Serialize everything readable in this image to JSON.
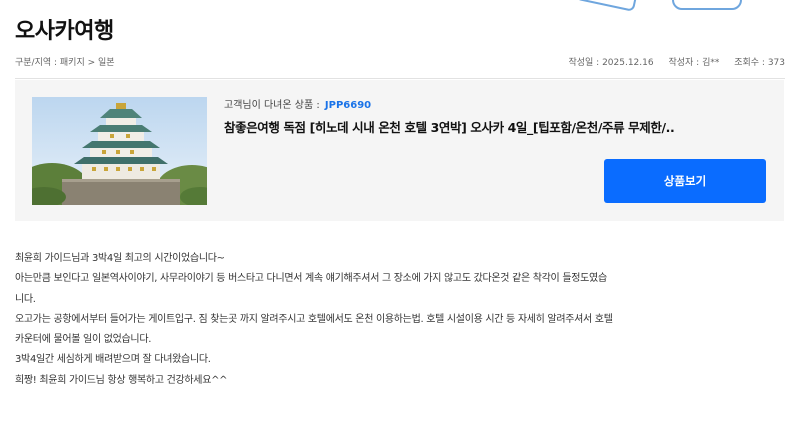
{
  "page": {
    "title": "오사카여행"
  },
  "meta": {
    "breadcrumb": "구분/지역 : 패키지 > 일본",
    "date": "작성일 : 2025.12.16",
    "author": "작성자 : 김**",
    "views": "조회수 : 373"
  },
  "product": {
    "code_label": "고객님이 다녀온 상품 :",
    "code": "JPP6690",
    "name": "참좋은여행 독점 [히노데 시내 온천 호텔 3연박] 오사카 4일_[팁포함/온천/주류 무제한/..",
    "button_label": "상품보기"
  },
  "review": {
    "lines": [
      "최윤희 가이드님과 3박4일 최고의 시간이었습니다~",
      "아는만큼 보인다고 일본역사이야기, 사무라이야기 등 버스타고 다니면서 계속 얘기해주셔서  그 장소에 가지 않고도 갔다온것 같은 착각이 들정도였습",
      "니다.",
      "오고가는 공항에서부터 들어가는 게이트입구. 짐 찾는곳 까지 알려주시고 호텔에서도 온천 이용하는법. 호텔 시설이용 시간 등 자세히 알려주셔서 호텔",
      "카운터에 물어볼 일이 없었습니다.",
      "3박4일간 세심하게 배려받으며 잘 다녀왔습니다.",
      "희짱! 최윤희 가이드님  항상 행복하고 건강하세요^^"
    ]
  },
  "colors": {
    "accent": "#0a6cff",
    "code": "#1a73e8",
    "card_bg": "#f5f5f5"
  }
}
